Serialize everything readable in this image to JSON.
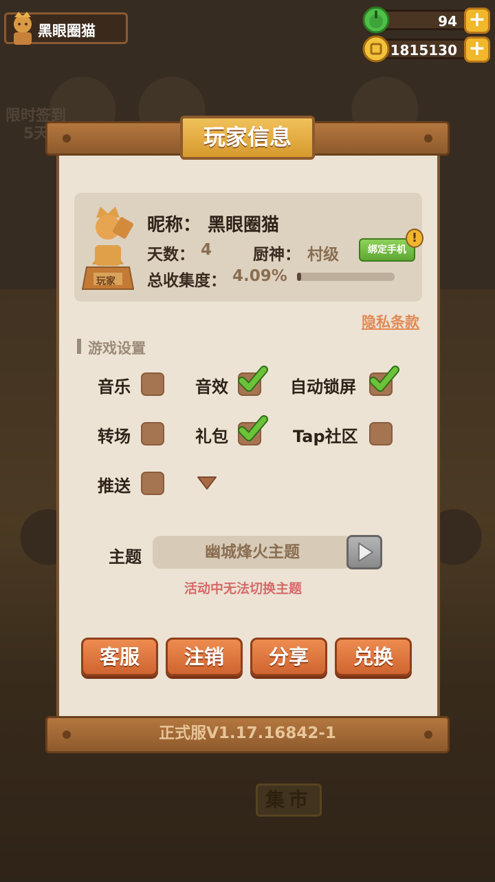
{
  "hud": {
    "player_name": "黑眼圈猫",
    "energy": "94",
    "coins": "1815130"
  },
  "background": {
    "signin": "限时签到",
    "signin_days": "5天",
    "market": "集市"
  },
  "panel": {
    "title": "玩家信息",
    "nickname_label": "昵称：",
    "nickname_value": "黑眼圈猫",
    "days_label": "天数：",
    "days_value": "4",
    "chef_label": "厨神：",
    "chef_value": "村级",
    "bind_phone": "绑定手机",
    "alert_mark": "!",
    "collection_label": "总收集度：",
    "collection_value": "4.09%",
    "collection_fraction": 0.0409,
    "trophy_badge": "玩家",
    "privacy_link": "隐私条款",
    "settings_title": "游戏设置",
    "options": [
      {
        "label": "音乐",
        "checked": false
      },
      {
        "label": "音效",
        "checked": true
      },
      {
        "label": "自动锁屏",
        "checked": true
      },
      {
        "label": "转场",
        "checked": false
      },
      {
        "label": "礼包",
        "checked": true
      },
      {
        "label": "Tap社区",
        "checked": false
      },
      {
        "label": "推送",
        "checked": false
      }
    ],
    "theme_label": "主题",
    "theme_value": "幽城烽火主题",
    "theme_note": "活动中无法切换主题",
    "buttons": {
      "service": "客服",
      "logout": "注销",
      "share": "分享",
      "redeem": "兑换"
    },
    "version": "正式服V1.17.16842-1"
  },
  "colors": {
    "panel_bg": "#ece3d4",
    "wood": "#8e5a2c",
    "accent_orange": "#cf6430",
    "check_green": "#6cc33a",
    "note_red": "#d66a6a"
  }
}
